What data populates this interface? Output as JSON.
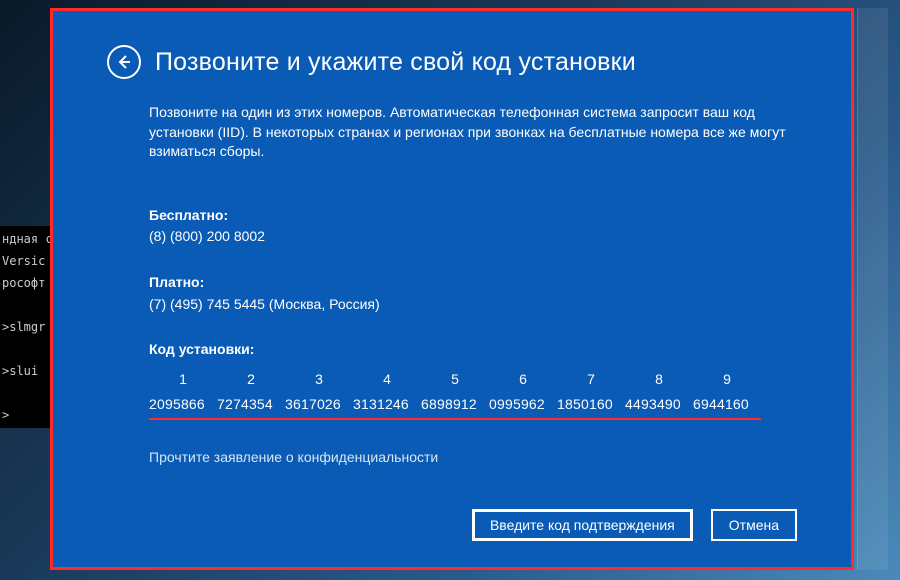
{
  "cmd": {
    "lines": "ндная ст\nVersic\nрософт\n\n>slmgr\n\n>slui\n\n>"
  },
  "dialog": {
    "title": "Позвоните и укажите свой код установки",
    "intro": "Позвоните на один из этих номеров. Автоматическая телефонная система запросит ваш код установки (IID). В некоторых странах и регионах при звонках на бесплатные номера все же могут взиматься сборы.",
    "free_label": "Бесплатно:",
    "free_number": "(8) (800) 200 8002",
    "paid_label": "Платно:",
    "paid_number": "(7) (495) 745 5445 (Москва, Россия)",
    "iid_label": "Код установки:",
    "iid_headers": [
      "1",
      "2",
      "3",
      "4",
      "5",
      "6",
      "7",
      "8",
      "9"
    ],
    "iid_values": [
      "2095866",
      "7274354",
      "3617026",
      "3131246",
      "6898912",
      "0995962",
      "1850160",
      "4493490",
      "6944160"
    ],
    "privacy": "Прочтите заявление о конфиденциальности",
    "primary_btn": "Введите код подтверждения",
    "cancel_btn": "Отмена"
  }
}
